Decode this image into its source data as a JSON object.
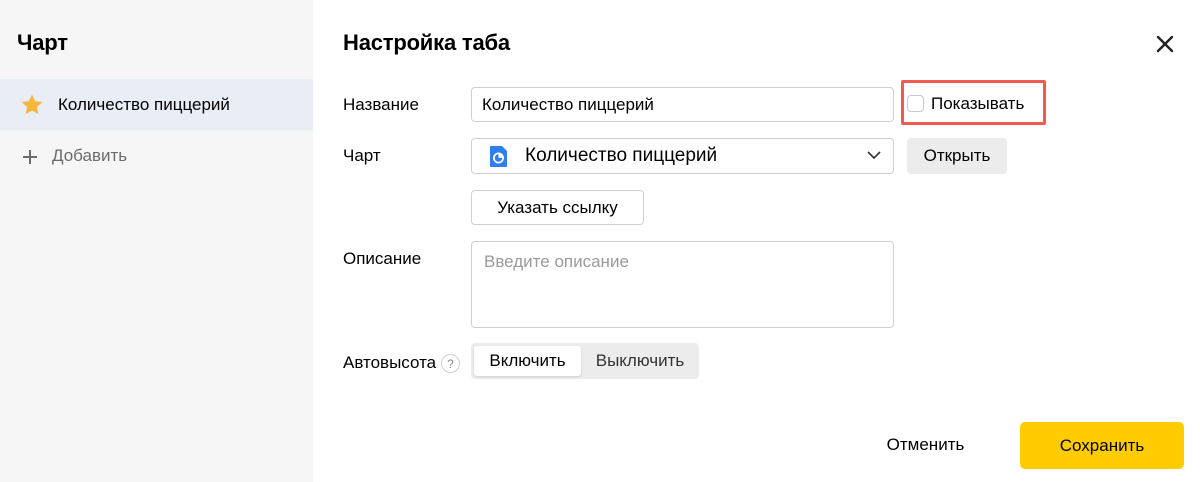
{
  "sidebar": {
    "title": "Чарт",
    "tabs": [
      {
        "label": "Количество пиццерий",
        "icon": "star-icon",
        "icon_color": "#f5b740",
        "selected": true
      }
    ],
    "add_label": "Добавить"
  },
  "panel": {
    "title": "Настройка таба",
    "name": {
      "label": "Название",
      "value": "Количество пиццерий",
      "show_checkbox_label": "Показывать",
      "show_checked": false
    },
    "chart": {
      "label": "Чарт",
      "selected": "Количество пиццерий",
      "icon": "pie-chart-icon",
      "icon_color": "#2f7ff0",
      "open_label": "Открыть",
      "link_label": "Указать ссылку"
    },
    "description": {
      "label": "Описание",
      "placeholder": "Введите описание",
      "value": ""
    },
    "autoheight": {
      "label": "Автовысота",
      "help": "?",
      "options": [
        "Включить",
        "Выключить"
      ],
      "selected": "Включить"
    }
  },
  "footer": {
    "cancel_label": "Отменить",
    "save_label": "Сохранить",
    "save_color": "#ffcc00"
  },
  "highlight_color": "#ef5b4e"
}
